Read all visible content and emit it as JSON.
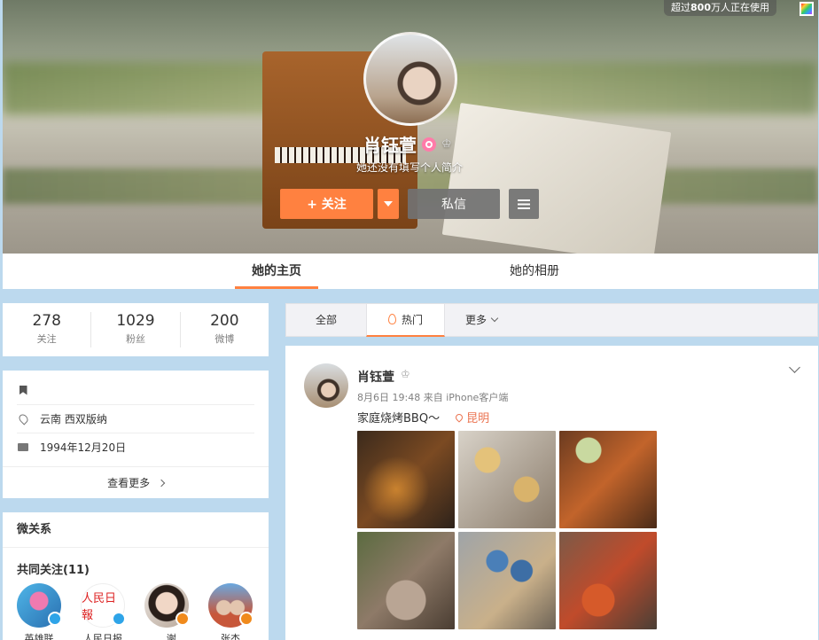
{
  "cover": {
    "users_badge_prefix": "超过",
    "users_badge_count": "800",
    "users_badge_suffix": "万人正在使用"
  },
  "profile": {
    "name": "肖钰萱",
    "bio": "她还没有填写个人简介",
    "follow_label": "+ 关注",
    "message_label": "私信"
  },
  "tabs": {
    "home": "她的主页",
    "album": "她的相册"
  },
  "stats": [
    {
      "num": "278",
      "label": "关注"
    },
    {
      "num": "1029",
      "label": "粉丝"
    },
    {
      "num": "200",
      "label": "微博"
    }
  ],
  "info": {
    "location": "云南 西双版纳",
    "birthday": "1994年12月20日",
    "more": "查看更多"
  },
  "relations": {
    "title": "微关系",
    "common_follow": "共同关注(11)",
    "friends": [
      {
        "name": "英雄联"
      },
      {
        "name": "人民日报"
      },
      {
        "name": "...谢"
      },
      {
        "name": "张杰"
      }
    ]
  },
  "feed": {
    "tab_all": "全部",
    "tab_hot": "热门",
    "tab_more": "更多"
  },
  "post": {
    "name": "肖钰萱",
    "date": "8月6日 19:48",
    "source": "来自 iPhone客户端",
    "text": "家庭烧烤BBQ～",
    "location": "昆明"
  },
  "colors": {
    "accent": "#ff8140",
    "link": "#eb7350",
    "background": "#bcd9ee"
  }
}
